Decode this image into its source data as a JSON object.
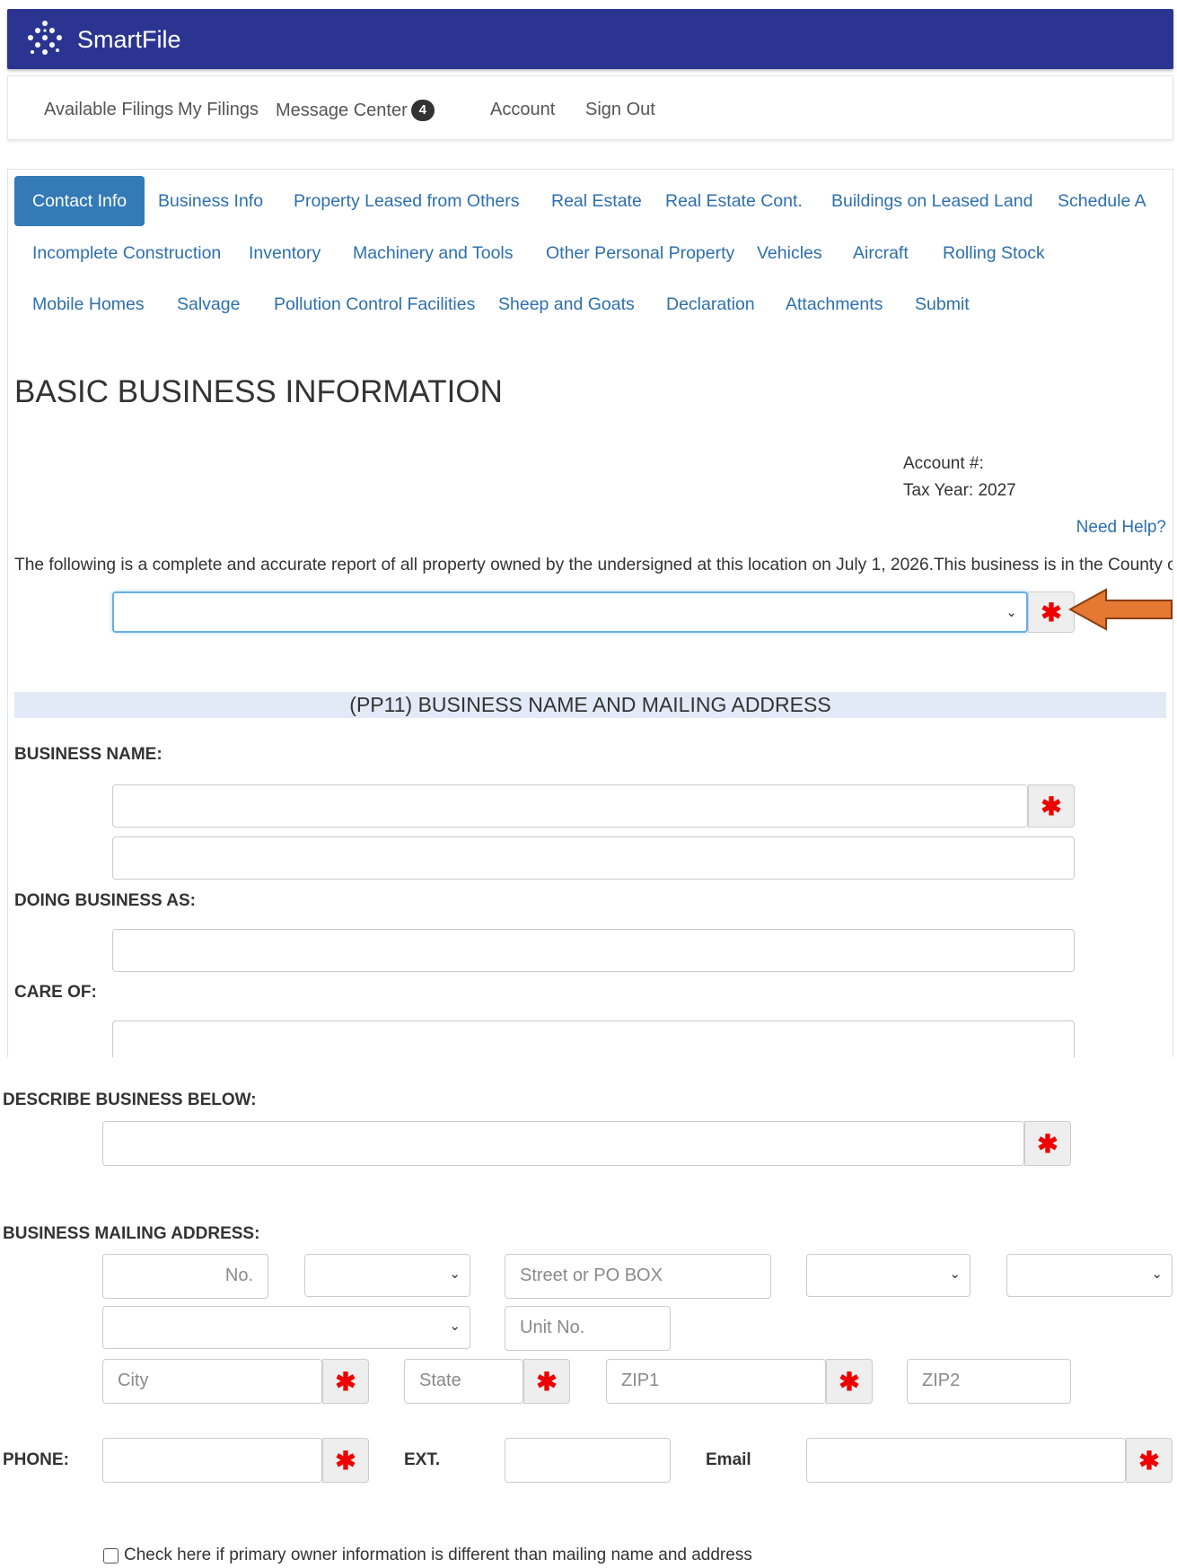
{
  "app": {
    "name": "SmartFile"
  },
  "nav": {
    "items": [
      "Available Filings",
      "My Filings",
      "Message Center",
      "Account",
      "Sign Out"
    ],
    "message_count": "4"
  },
  "tabs": [
    "Contact Info",
    "Business Info",
    "Property Leased from Others",
    "Real Estate",
    "Real Estate Cont.",
    "Buildings on Leased Land",
    "Schedule A",
    "Incomplete Construction",
    "Inventory",
    "Machinery and Tools",
    "Other Personal Property",
    "Vehicles",
    "Aircraft",
    "Rolling Stock",
    "Mobile Homes",
    "Salvage",
    "Pollution Control Facilities",
    "Sheep and Goats",
    "Declaration",
    "Attachments",
    "Submit"
  ],
  "page": {
    "title": "BASIC BUSINESS INFORMATION",
    "account_label": "Account #:",
    "tax_year": "Tax Year: 2027",
    "help_link": "Need Help?",
    "intro": "The following is a complete and accurate report of all property owned by the undersigned at this location on July 1, 2026.This business is in the County of",
    "county_value": ""
  },
  "section": {
    "title": "(PP11) BUSINESS NAME AND MAILING ADDRESS"
  },
  "labels": {
    "business_name": "BUSINESS NAME:",
    "dba": "DOING BUSINESS AS:",
    "care_of": "CARE OF:",
    "describe": "DESCRIBE BUSINESS BELOW:",
    "mailing": "BUSINESS MAILING ADDRESS:",
    "phone": "PHONE:",
    "ext": "EXT.",
    "email": "Email"
  },
  "placeholders": {
    "no": "No.",
    "street": "Street or PO BOX",
    "unit": "Unit No.",
    "city": "City",
    "state": "State",
    "zip1": "ZIP1",
    "zip2": "ZIP2"
  },
  "required_mark": "✱",
  "checkbox": {
    "label": "Check here if primary owner information is different than mailing name and address",
    "checked": false
  },
  "colors": {
    "header": "#2b3591",
    "link": "#2d6fae",
    "active_tab": "#337ab7",
    "section_bg": "#e1eaf6",
    "required": "#ee0000",
    "arrow": "#e57832"
  }
}
